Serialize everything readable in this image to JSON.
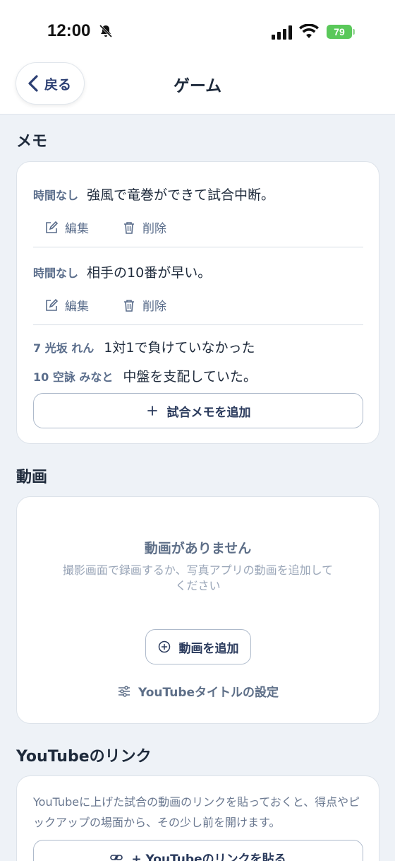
{
  "status": {
    "time": "12:00",
    "battery": "79"
  },
  "nav": {
    "back_label": "戻る",
    "title": "ゲーム"
  },
  "memo": {
    "section_title": "メモ",
    "entries": [
      {
        "time": "時間なし",
        "text": "強風で竜巻ができて試合中断。"
      },
      {
        "time": "時間なし",
        "text": "相手の10番が早い。"
      }
    ],
    "edit_label": "編集",
    "delete_label": "削除",
    "player_notes": [
      {
        "player": "7 光坂 れん",
        "text": "1対1で負けていなかった"
      },
      {
        "player": "10 空詠 みなと",
        "text": "中盤を支配していた。"
      }
    ],
    "add_button": "試合メモを追加"
  },
  "video": {
    "section_title": "動画",
    "empty_title": "動画がありません",
    "empty_desc": "撮影画面で録画するか、写真アプリの動画を追加してください",
    "add_button": "動画を追加",
    "yt_settings": "YouTubeタイトルの設定"
  },
  "youtube": {
    "section_title": "YouTubeのリンク",
    "description": "YouTubeに上げた試合の動画のリンクを貼っておくと、得点やピックアップの場面から、その少し前を開けます。",
    "paste_button": "+ YouTubeのリンクを貼る"
  },
  "colors": {
    "background": "#eef2f7",
    "accent": "#2c3f73",
    "muted": "#5a6d8b",
    "battery": "#5ac85a"
  }
}
